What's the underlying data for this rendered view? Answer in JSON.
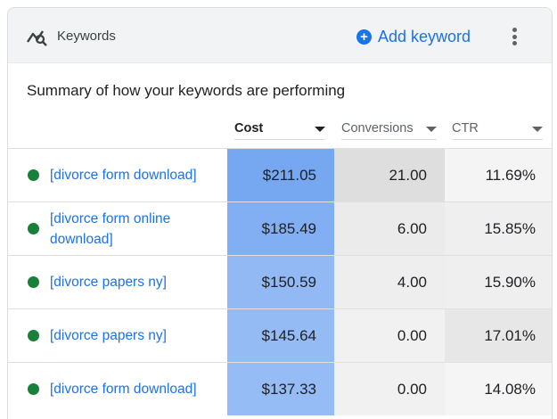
{
  "header": {
    "title": "Keywords",
    "add_label": "Add keyword"
  },
  "summary": "Summary of how your keywords are performing",
  "columns": {
    "cost": "Cost",
    "conversions": "Conversions",
    "ctr": "CTR"
  },
  "colors": {
    "accent": "#1a73e8",
    "status_dot": "#188038",
    "cost_heat": [
      "#76a7f1",
      "#82aef3",
      "#93b9f5",
      "#95bbf5",
      "#96bcf5"
    ],
    "conv_heat": [
      "#dedede",
      "#ebebeb",
      "#eeeeee",
      "#f1f1f1",
      "#f1f1f1"
    ],
    "ctr_heat": [
      "#f4f4f4",
      "#efefef",
      "#efefef",
      "#e7e7e7",
      "#f5f5f5"
    ]
  },
  "rows": [
    {
      "keyword": "[divorce form download]",
      "cost": "$211.05",
      "conversions": "21.00",
      "ctr": "11.69%"
    },
    {
      "keyword": "[divorce form online download]",
      "cost": "$185.49",
      "conversions": "6.00",
      "ctr": "15.85%"
    },
    {
      "keyword": "[divorce papers ny]",
      "cost": "$150.59",
      "conversions": "4.00",
      "ctr": "15.90%"
    },
    {
      "keyword": "[divorce papers ny]",
      "cost": "$145.64",
      "conversions": "0.00",
      "ctr": "17.01%"
    },
    {
      "keyword": "[divorce form download]",
      "cost": "$137.33",
      "conversions": "0.00",
      "ctr": "14.08%"
    }
  ]
}
